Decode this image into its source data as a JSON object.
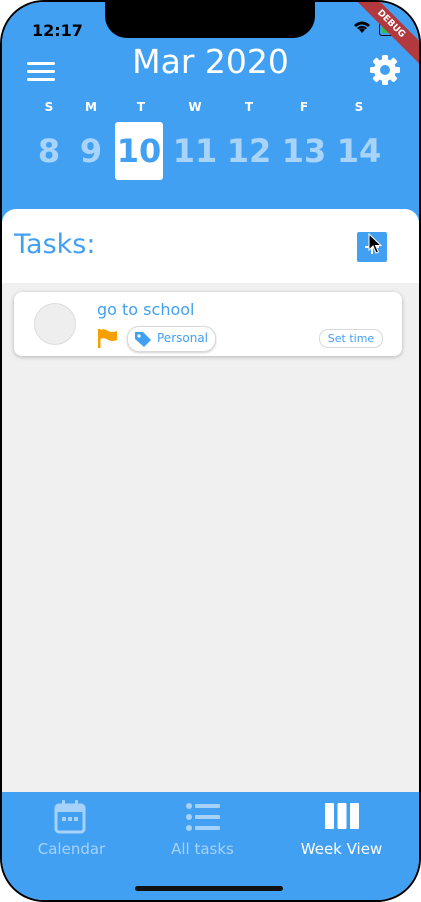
{
  "status": {
    "time": "12:17",
    "debug_label": "DEBUG"
  },
  "header": {
    "month_year": "Mar 2020",
    "weekdays": [
      "S",
      "M",
      "T",
      "W",
      "T",
      "F",
      "S"
    ],
    "days": [
      "8",
      "9",
      "10",
      "11",
      "12",
      "13",
      "14"
    ],
    "selected_day": "10"
  },
  "tasks": {
    "heading": "Tasks:",
    "items": [
      {
        "title": "go to school",
        "tag": "Personal",
        "set_time_label": "Set time",
        "flag_color": "#f5a000"
      }
    ]
  },
  "nav": {
    "items": [
      {
        "label": "Calendar",
        "active": false
      },
      {
        "label": "All tasks",
        "active": false
      },
      {
        "label": "Week View",
        "active": true
      }
    ]
  },
  "colors": {
    "accent": "#42a0f3",
    "background": "#f0f0f0",
    "inactive_nav": "#a6d1f9",
    "flag": "#f5a000",
    "debug_banner": "#b2393d"
  }
}
